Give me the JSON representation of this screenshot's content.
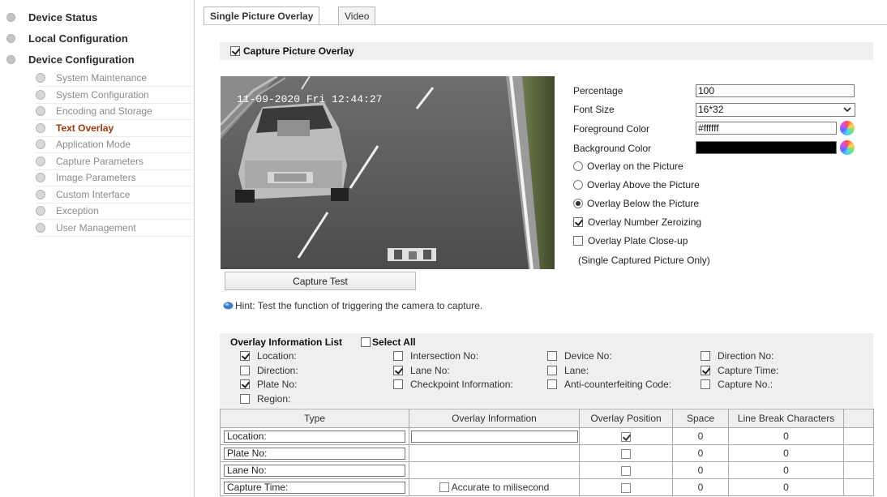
{
  "nav": {
    "top": [
      {
        "label": "Device Status"
      },
      {
        "label": "Local Configuration"
      },
      {
        "label": "Device Configuration"
      }
    ],
    "sub": [
      {
        "label": "System Maintenance"
      },
      {
        "label": "System Configuration"
      },
      {
        "label": "Encoding and Storage"
      },
      {
        "label": "Text Overlay",
        "active": true
      },
      {
        "label": "Application Mode"
      },
      {
        "label": "Capture Parameters"
      },
      {
        "label": "Image Parameters"
      },
      {
        "label": "Custom Interface"
      },
      {
        "label": "Exception"
      },
      {
        "label": "User Management"
      }
    ]
  },
  "tabs": [
    {
      "label": "Single Picture Overlay",
      "active": true
    },
    {
      "label": "Video"
    }
  ],
  "capture_overlay": {
    "label": "Capture Picture Overlay",
    "checked": true
  },
  "snapshot": {
    "timestamp": "11-09-2020 Fri 12:44:27"
  },
  "capture_test_label": "Capture Test",
  "hint": "Hint: Test the function of triggering the camera to capture.",
  "form": {
    "percentage_label": "Percentage",
    "percentage_value": "100",
    "font_size_label": "Font Size",
    "font_size_value": "16*32",
    "fg_label": "Foreground Color",
    "fg_value": "#ffffff",
    "bg_label": "Background Color",
    "bg_color": "#000000",
    "radios": [
      {
        "label": "Overlay on the Picture",
        "checked": false
      },
      {
        "label": "Overlay Above the Picture",
        "checked": false
      },
      {
        "label": "Overlay Below the Picture",
        "checked": true
      }
    ],
    "zeroizing": {
      "label": "Overlay Number Zeroizing",
      "checked": true
    },
    "closeup": {
      "label": "Overlay Plate Close-up",
      "checked": false
    },
    "closeup_note": "(Single Captured Picture Only)"
  },
  "info_list": {
    "title": "Overlay Information List",
    "select_all": "Select All",
    "items": [
      {
        "label": "Location:",
        "checked": true
      },
      {
        "label": "Intersection No:",
        "checked": false
      },
      {
        "label": "Device No:",
        "checked": false
      },
      {
        "label": "Direction No:",
        "checked": false
      },
      {
        "label": "Direction:",
        "checked": false
      },
      {
        "label": "Lane No:",
        "checked": true
      },
      {
        "label": "Lane:",
        "checked": false
      },
      {
        "label": "Capture Time:",
        "checked": true
      },
      {
        "label": "Plate No:",
        "checked": true
      },
      {
        "label": "Checkpoint Information:",
        "checked": false
      },
      {
        "label": "Anti-counterfeiting Code:",
        "checked": false
      },
      {
        "label": "Capture No.:",
        "checked": false
      },
      {
        "label": "Region:",
        "checked": false
      }
    ]
  },
  "table": {
    "headers": [
      "Type",
      "Overlay Information",
      "Overlay Position",
      "Space",
      "Line Break Characters"
    ],
    "rows": [
      {
        "type": "Location:",
        "info": "",
        "position": true,
        "space": "0",
        "line_break": "0"
      },
      {
        "type": "Plate No:",
        "info": null,
        "position": false,
        "space": "0",
        "line_break": "0"
      },
      {
        "type": "Lane No:",
        "info": null,
        "position": false,
        "space": "0",
        "line_break": "0"
      },
      {
        "type": "Capture Time:",
        "info_check_label": "Accurate to milisecond",
        "position": false,
        "space": "0",
        "line_break": "0"
      }
    ]
  }
}
